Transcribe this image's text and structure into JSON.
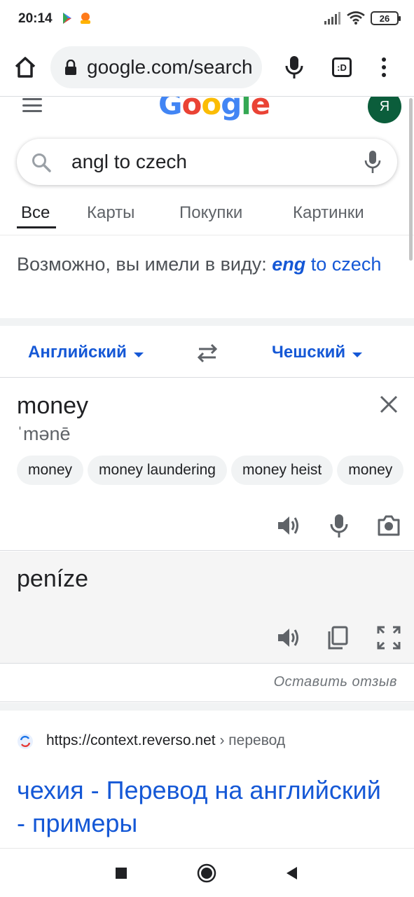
{
  "status_bar": {
    "time": "20:14",
    "battery": "26"
  },
  "browser": {
    "url": "google.com/search",
    "tabs_count": ":D"
  },
  "google": {
    "logo": "Google",
    "avatar_letter": "Я"
  },
  "search": {
    "query": "angl to czech"
  },
  "tabs": [
    {
      "label": "Все",
      "active": true
    },
    {
      "label": "Карты",
      "active": false
    },
    {
      "label": "Покупки",
      "active": false
    },
    {
      "label": "Картинки",
      "active": false
    }
  ],
  "did_you_mean": {
    "prefix": "Возможно, вы имели в виду:",
    "suggest_bold": "eng",
    "suggest_rest": " to czech"
  },
  "translator": {
    "source_lang": "Английский",
    "target_lang": "Чешский",
    "source_text": "money",
    "phonetic": "ˈmənē",
    "chips": [
      "money",
      "money laundering",
      "money heist",
      "money"
    ],
    "target_text": "peníze",
    "feedback": "Оставить отзыв"
  },
  "result": {
    "cite_url": "https://context.reverso.net",
    "cite_crumb": " › перевод",
    "title": "чехия - Перевод на английский - примеры"
  },
  "colors": {
    "link": "#1558d6",
    "avatar_bg": "#0b5d3b"
  },
  "icons": [
    "home-icon",
    "lock-icon",
    "mic-icon",
    "search-icon",
    "swap-icon",
    "close-icon",
    "speaker-icon",
    "camera-icon",
    "copy-icon",
    "fullscreen-icon",
    "reverso-icon"
  ]
}
